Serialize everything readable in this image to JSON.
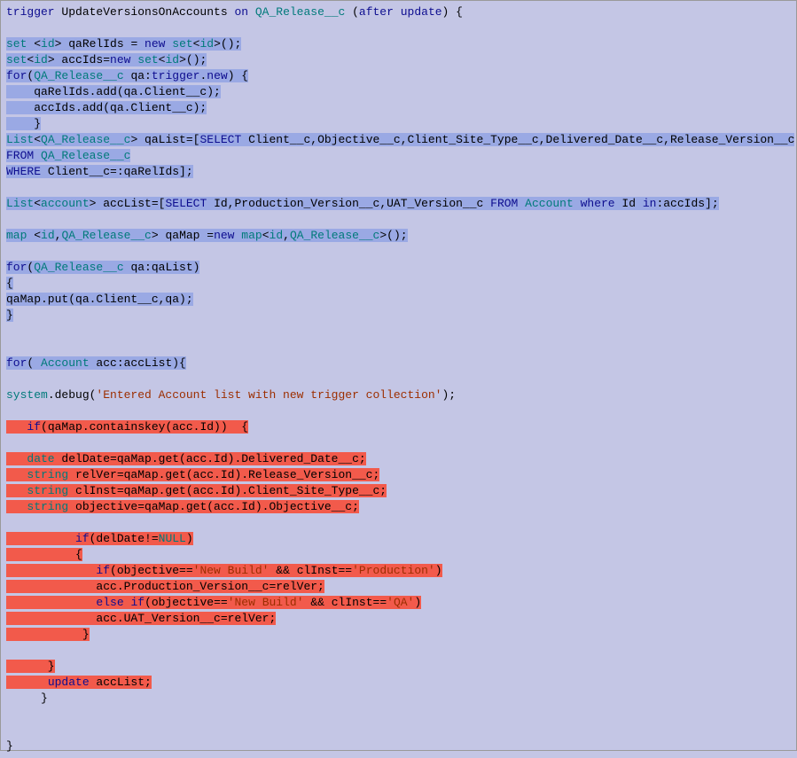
{
  "language": "Apex",
  "triggerName": "UpdateVersionsOnAccounts",
  "triggerObject": "QA_Release__c",
  "triggerEvent": "after update",
  "code_lines": [
    {
      "t": "trigger UpdateVersionsOnAccounts on QA_Release__c (after update) {",
      "hl": null
    },
    {
      "t": "",
      "hl": null
    },
    {
      "t": "set <id> qaRelIds = new set<id>();",
      "hl": "blue",
      "pad": 0
    },
    {
      "t": "set<id> accIds=new set<id>();",
      "hl": "blue",
      "pad": 0
    },
    {
      "t": "for(QA_Release__c qa:trigger.new) {",
      "hl": "blue",
      "pad": 0
    },
    {
      "t": "    qaRelIds.add(qa.Client__c);",
      "hl": "blue",
      "pad": 0
    },
    {
      "t": "    accIds.add(qa.Client__c);",
      "hl": "blue",
      "pad": 0
    },
    {
      "t": "    }",
      "hl": "blue",
      "pad": 0
    },
    {
      "t": "List<QA_Release__c> qaList=[SELECT Client__c,Objective__c,Client_Site_Type__c,Delivered_Date__c,Release_Version__c",
      "hl": "blue",
      "pad": 0
    },
    {
      "t": "FROM QA_Release__c",
      "hl": "blue",
      "pad": 0
    },
    {
      "t": "WHERE Client__c=:qaRelIds];",
      "hl": "blue",
      "pad": 0
    },
    {
      "t": "",
      "hl": null
    },
    {
      "t": "List<account> accList=[SELECT Id,Production_Version__c,UAT_Version__c FROM Account where Id in:accIds];",
      "hl": "blue",
      "pad": 0
    },
    {
      "t": "",
      "hl": null
    },
    {
      "t": "map <id,QA_Release__c> qaMap =new map<id,QA_Release__c>();",
      "hl": "blue",
      "pad": 0
    },
    {
      "t": "",
      "hl": null
    },
    {
      "t": "for(QA_Release__c qa:qaList)",
      "hl": "blue",
      "pad": 0
    },
    {
      "t": "{",
      "hl": "blue",
      "pad": 0
    },
    {
      "t": "qaMap.put(qa.Client__c,qa);",
      "hl": "blue",
      "pad": 0
    },
    {
      "t": "}",
      "hl": "blue",
      "pad": 0
    },
    {
      "t": "",
      "hl": null
    },
    {
      "t": "",
      "hl": null
    },
    {
      "t": "for( Account acc:accList){",
      "hl": "blue",
      "pad": 0
    },
    {
      "t": "",
      "hl": null
    },
    {
      "t": "system.debug('Entered Account list with new trigger collection');",
      "hl": null
    },
    {
      "t": "",
      "hl": null
    },
    {
      "t": "   if(qaMap.containskey(acc.Id))  {",
      "hl": "red",
      "pad": 0
    },
    {
      "t": "",
      "hl": null
    },
    {
      "t": "   date delDate=qaMap.get(acc.Id).Delivered_Date__c;",
      "hl": "red",
      "pad": 0
    },
    {
      "t": "   string relVer=qaMap.get(acc.Id).Release_Version__c;",
      "hl": "red",
      "pad": 0
    },
    {
      "t": "   string clInst=qaMap.get(acc.Id).Client_Site_Type__c;",
      "hl": "red",
      "pad": 0
    },
    {
      "t": "   string objective=qaMap.get(acc.Id).Objective__c;",
      "hl": "red",
      "pad": 0
    },
    {
      "t": "",
      "hl": null
    },
    {
      "t": "          if(delDate!=NULL)",
      "hl": "red",
      "pad": 0
    },
    {
      "t": "          {",
      "hl": "red",
      "pad": 0
    },
    {
      "t": "             if(objective=='New Build' && clInst=='Production')",
      "hl": "red",
      "pad": 0
    },
    {
      "t": "             acc.Production_Version__c=relVer;",
      "hl": "red",
      "pad": 0
    },
    {
      "t": "             else if(objective=='New Build' && clInst=='QA')",
      "hl": "red",
      "pad": 0
    },
    {
      "t": "             acc.UAT_Version__c=relVer;",
      "hl": "red",
      "pad": 0
    },
    {
      "t": "           }",
      "hl": "red",
      "pad": 0
    },
    {
      "t": "",
      "hl": null
    },
    {
      "t": "      }",
      "hl": "red",
      "pad": 0
    },
    {
      "t": "      update accList;",
      "hl": "red",
      "pad": 0
    },
    {
      "t": "     }",
      "hl": null
    },
    {
      "t": "",
      "hl": null
    },
    {
      "t": "",
      "hl": null
    },
    {
      "t": "}",
      "hl": null
    }
  ],
  "syntax": {
    "keywords": [
      "trigger",
      "on",
      "after",
      "update",
      "new",
      "for",
      "if",
      "else",
      "in",
      "where",
      "FROM",
      "SELECT",
      "WHERE"
    ],
    "types": [
      "set",
      "List",
      "map",
      "id",
      "account",
      "Account",
      "QA_Release__c",
      "date",
      "string",
      "NULL"
    ],
    "strings_color": "#9c2e00"
  }
}
